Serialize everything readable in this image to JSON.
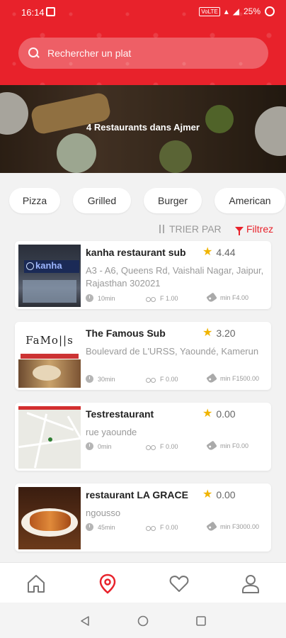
{
  "status_bar": {
    "time": "16:14",
    "signal_label": "VoLTE",
    "battery": "25%"
  },
  "search": {
    "placeholder": "Rechercher un plat"
  },
  "banner": {
    "title": "4 Restaurants dans Ajmer"
  },
  "chips": [
    "Pizza",
    "Grilled",
    "Burger",
    "American"
  ],
  "toolbar": {
    "sort_label": "TRIER PAR",
    "filter_label": "Filtrez"
  },
  "restaurants": [
    {
      "name": "kanha restaurant sub",
      "rating": "4.44",
      "address": "A3 - A6, Queens Rd, Vaishali Nagar, Jaipur, Rajasthan 302021",
      "time": "10min",
      "delivery": "F 1.00",
      "min": "min F4.00",
      "thumb_text": "kanha"
    },
    {
      "name": "The Famous Sub",
      "rating": "3.20",
      "address": "Boulevard de L'URSS, Yaoundé, Kamerun",
      "time": "30min",
      "delivery": "F 0.00",
      "min": "min F1500.00",
      "thumb_text": "FaMo||s"
    },
    {
      "name": "Testrestaurant",
      "rating": "0.00",
      "address": "rue yaounde",
      "time": "0min",
      "delivery": "F 0.00",
      "min": "min F0.00"
    },
    {
      "name": "restaurant LA GRACE",
      "rating": "0.00",
      "address": "ngousso",
      "time": "45min",
      "delivery": "F 0.00",
      "min": "min F3000.00"
    }
  ],
  "colors": {
    "accent": "#e8222b",
    "star": "#f0b400"
  }
}
